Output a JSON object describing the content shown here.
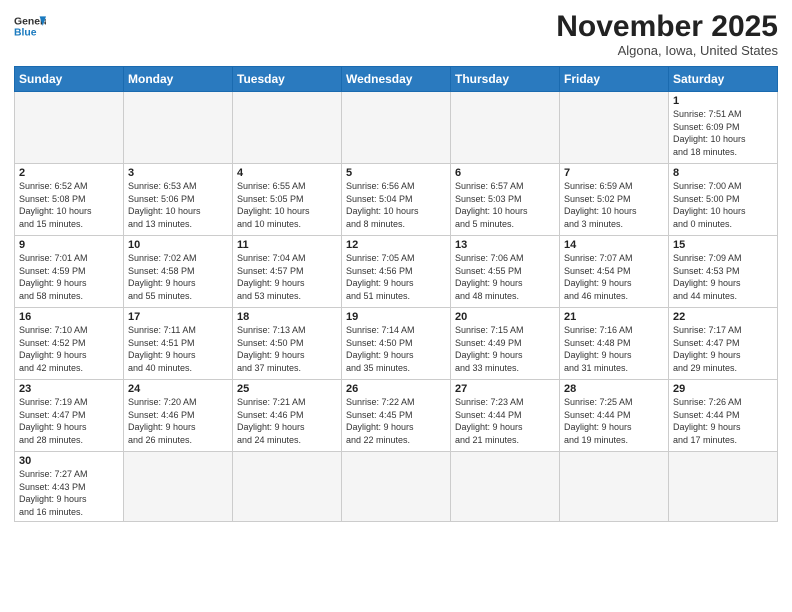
{
  "header": {
    "logo_general": "General",
    "logo_blue": "Blue",
    "month_title": "November 2025",
    "location": "Algona, Iowa, United States"
  },
  "weekdays": [
    "Sunday",
    "Monday",
    "Tuesday",
    "Wednesday",
    "Thursday",
    "Friday",
    "Saturday"
  ],
  "weeks": [
    [
      {
        "day": "",
        "info": ""
      },
      {
        "day": "",
        "info": ""
      },
      {
        "day": "",
        "info": ""
      },
      {
        "day": "",
        "info": ""
      },
      {
        "day": "",
        "info": ""
      },
      {
        "day": "",
        "info": ""
      },
      {
        "day": "1",
        "info": "Sunrise: 7:51 AM\nSunset: 6:09 PM\nDaylight: 10 hours\nand 18 minutes."
      }
    ],
    [
      {
        "day": "2",
        "info": "Sunrise: 6:52 AM\nSunset: 5:08 PM\nDaylight: 10 hours\nand 15 minutes."
      },
      {
        "day": "3",
        "info": "Sunrise: 6:53 AM\nSunset: 5:06 PM\nDaylight: 10 hours\nand 13 minutes."
      },
      {
        "day": "4",
        "info": "Sunrise: 6:55 AM\nSunset: 5:05 PM\nDaylight: 10 hours\nand 10 minutes."
      },
      {
        "day": "5",
        "info": "Sunrise: 6:56 AM\nSunset: 5:04 PM\nDaylight: 10 hours\nand 8 minutes."
      },
      {
        "day": "6",
        "info": "Sunrise: 6:57 AM\nSunset: 5:03 PM\nDaylight: 10 hours\nand 5 minutes."
      },
      {
        "day": "7",
        "info": "Sunrise: 6:59 AM\nSunset: 5:02 PM\nDaylight: 10 hours\nand 3 minutes."
      },
      {
        "day": "8",
        "info": "Sunrise: 7:00 AM\nSunset: 5:00 PM\nDaylight: 10 hours\nand 0 minutes."
      }
    ],
    [
      {
        "day": "9",
        "info": "Sunrise: 7:01 AM\nSunset: 4:59 PM\nDaylight: 9 hours\nand 58 minutes."
      },
      {
        "day": "10",
        "info": "Sunrise: 7:02 AM\nSunset: 4:58 PM\nDaylight: 9 hours\nand 55 minutes."
      },
      {
        "day": "11",
        "info": "Sunrise: 7:04 AM\nSunset: 4:57 PM\nDaylight: 9 hours\nand 53 minutes."
      },
      {
        "day": "12",
        "info": "Sunrise: 7:05 AM\nSunset: 4:56 PM\nDaylight: 9 hours\nand 51 minutes."
      },
      {
        "day": "13",
        "info": "Sunrise: 7:06 AM\nSunset: 4:55 PM\nDaylight: 9 hours\nand 48 minutes."
      },
      {
        "day": "14",
        "info": "Sunrise: 7:07 AM\nSunset: 4:54 PM\nDaylight: 9 hours\nand 46 minutes."
      },
      {
        "day": "15",
        "info": "Sunrise: 7:09 AM\nSunset: 4:53 PM\nDaylight: 9 hours\nand 44 minutes."
      }
    ],
    [
      {
        "day": "16",
        "info": "Sunrise: 7:10 AM\nSunset: 4:52 PM\nDaylight: 9 hours\nand 42 minutes."
      },
      {
        "day": "17",
        "info": "Sunrise: 7:11 AM\nSunset: 4:51 PM\nDaylight: 9 hours\nand 40 minutes."
      },
      {
        "day": "18",
        "info": "Sunrise: 7:13 AM\nSunset: 4:50 PM\nDaylight: 9 hours\nand 37 minutes."
      },
      {
        "day": "19",
        "info": "Sunrise: 7:14 AM\nSunset: 4:50 PM\nDaylight: 9 hours\nand 35 minutes."
      },
      {
        "day": "20",
        "info": "Sunrise: 7:15 AM\nSunset: 4:49 PM\nDaylight: 9 hours\nand 33 minutes."
      },
      {
        "day": "21",
        "info": "Sunrise: 7:16 AM\nSunset: 4:48 PM\nDaylight: 9 hours\nand 31 minutes."
      },
      {
        "day": "22",
        "info": "Sunrise: 7:17 AM\nSunset: 4:47 PM\nDaylight: 9 hours\nand 29 minutes."
      }
    ],
    [
      {
        "day": "23",
        "info": "Sunrise: 7:19 AM\nSunset: 4:47 PM\nDaylight: 9 hours\nand 28 minutes."
      },
      {
        "day": "24",
        "info": "Sunrise: 7:20 AM\nSunset: 4:46 PM\nDaylight: 9 hours\nand 26 minutes."
      },
      {
        "day": "25",
        "info": "Sunrise: 7:21 AM\nSunset: 4:46 PM\nDaylight: 9 hours\nand 24 minutes."
      },
      {
        "day": "26",
        "info": "Sunrise: 7:22 AM\nSunset: 4:45 PM\nDaylight: 9 hours\nand 22 minutes."
      },
      {
        "day": "27",
        "info": "Sunrise: 7:23 AM\nSunset: 4:44 PM\nDaylight: 9 hours\nand 21 minutes."
      },
      {
        "day": "28",
        "info": "Sunrise: 7:25 AM\nSunset: 4:44 PM\nDaylight: 9 hours\nand 19 minutes."
      },
      {
        "day": "29",
        "info": "Sunrise: 7:26 AM\nSunset: 4:44 PM\nDaylight: 9 hours\nand 17 minutes."
      }
    ],
    [
      {
        "day": "30",
        "info": "Sunrise: 7:27 AM\nSunset: 4:43 PM\nDaylight: 9 hours\nand 16 minutes."
      },
      {
        "day": "",
        "info": ""
      },
      {
        "day": "",
        "info": ""
      },
      {
        "day": "",
        "info": ""
      },
      {
        "day": "",
        "info": ""
      },
      {
        "day": "",
        "info": ""
      },
      {
        "day": "",
        "info": ""
      }
    ]
  ]
}
